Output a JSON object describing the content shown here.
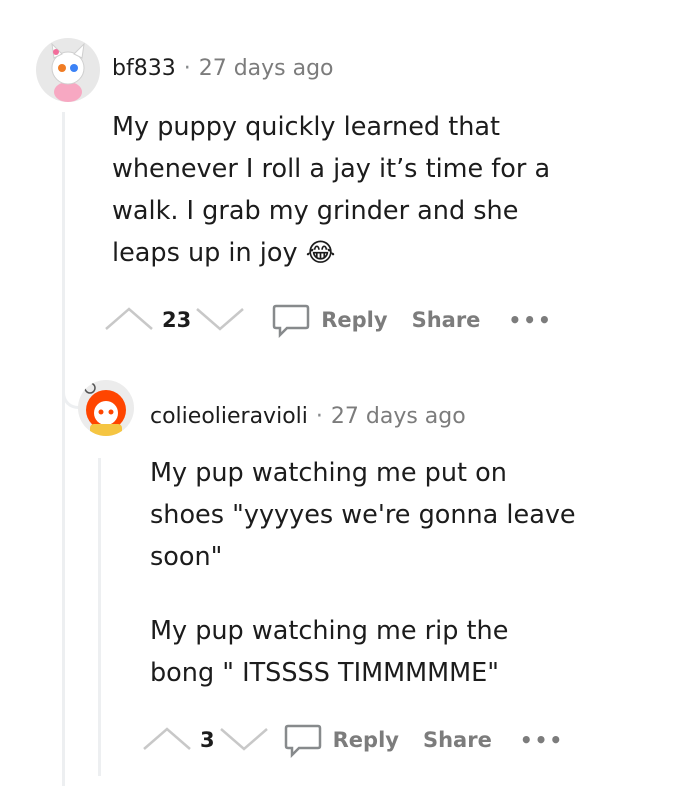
{
  "comments": [
    {
      "author": "bf833",
      "separator": "·",
      "time": "27 days ago",
      "body_lines": [
        "My puppy quickly learned that",
        "whenever I roll a jay it’s time for a",
        "walk. I grab my grinder and she",
        "leaps up in joy"
      ],
      "emoji": "😂",
      "score": "23",
      "reply_label": "Reply",
      "share_label": "Share",
      "more_label": "•••"
    },
    {
      "author": "colieolieravioli",
      "separator": "·",
      "time": "27 days ago",
      "paragraph1": [
        "My pup watching me put on",
        "shoes \"yyyyes we're gonna leave",
        "soon\""
      ],
      "paragraph2": [
        "My pup watching me rip the",
        "bong \" ITSSSS TIMMMMME\""
      ],
      "score": "3",
      "reply_label": "Reply",
      "share_label": "Share",
      "more_label": "•••"
    }
  ],
  "colors": {
    "thread_line": "#edeff1",
    "meta_text": "#7c7c7c",
    "action_text": "#7c7c7c",
    "icon_stroke": "#c8c8c8"
  }
}
